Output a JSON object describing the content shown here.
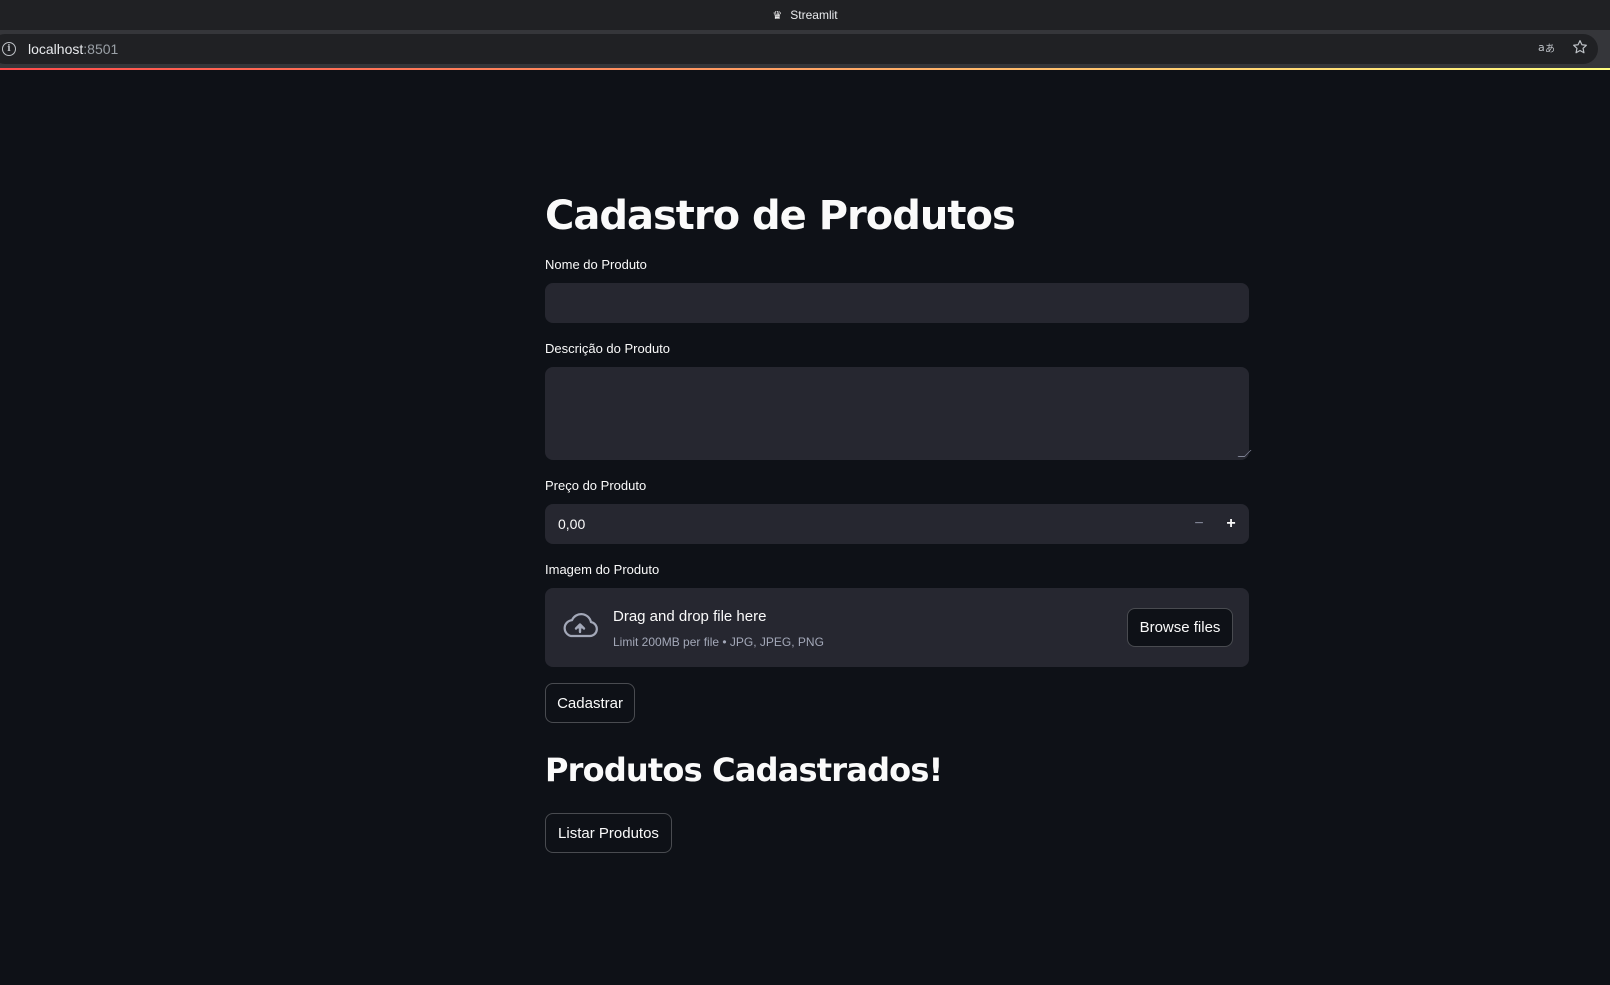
{
  "browser": {
    "window_title": "Streamlit",
    "url_host": "localhost",
    "url_port": ":8501"
  },
  "page": {
    "title": "Cadastro de Produtos",
    "form": {
      "nome_label": "Nome do Produto",
      "nome_value": "",
      "descricao_label": "Descrição do Produto",
      "descricao_value": "",
      "preco_label": "Preço do Produto",
      "preco_value": "0,00",
      "preco_decrement": "−",
      "preco_increment": "+",
      "imagem_label": "Imagem do Produto",
      "uploader_main": "Drag and drop file here",
      "uploader_sub": "Limit 200MB per file • JPG, JPEG, PNG",
      "browse_label": "Browse files",
      "submit_label": "Cadastrar"
    },
    "subtitle": "Produtos Cadastrados!",
    "listar_label": "Listar Produtos"
  },
  "colors": {
    "background": "#0e1117",
    "input_bg": "#262730",
    "text": "#fafafa",
    "accent_gradient_start": "#ff4b4b",
    "accent_gradient_end": "#fffd80"
  },
  "icons": {
    "tab_icon": "crown-icon",
    "address_icon": "info-icon",
    "translate_icon": "translate-icon",
    "bookmark_icon": "star-icon",
    "uploader_icon": "cloud-upload-icon"
  }
}
